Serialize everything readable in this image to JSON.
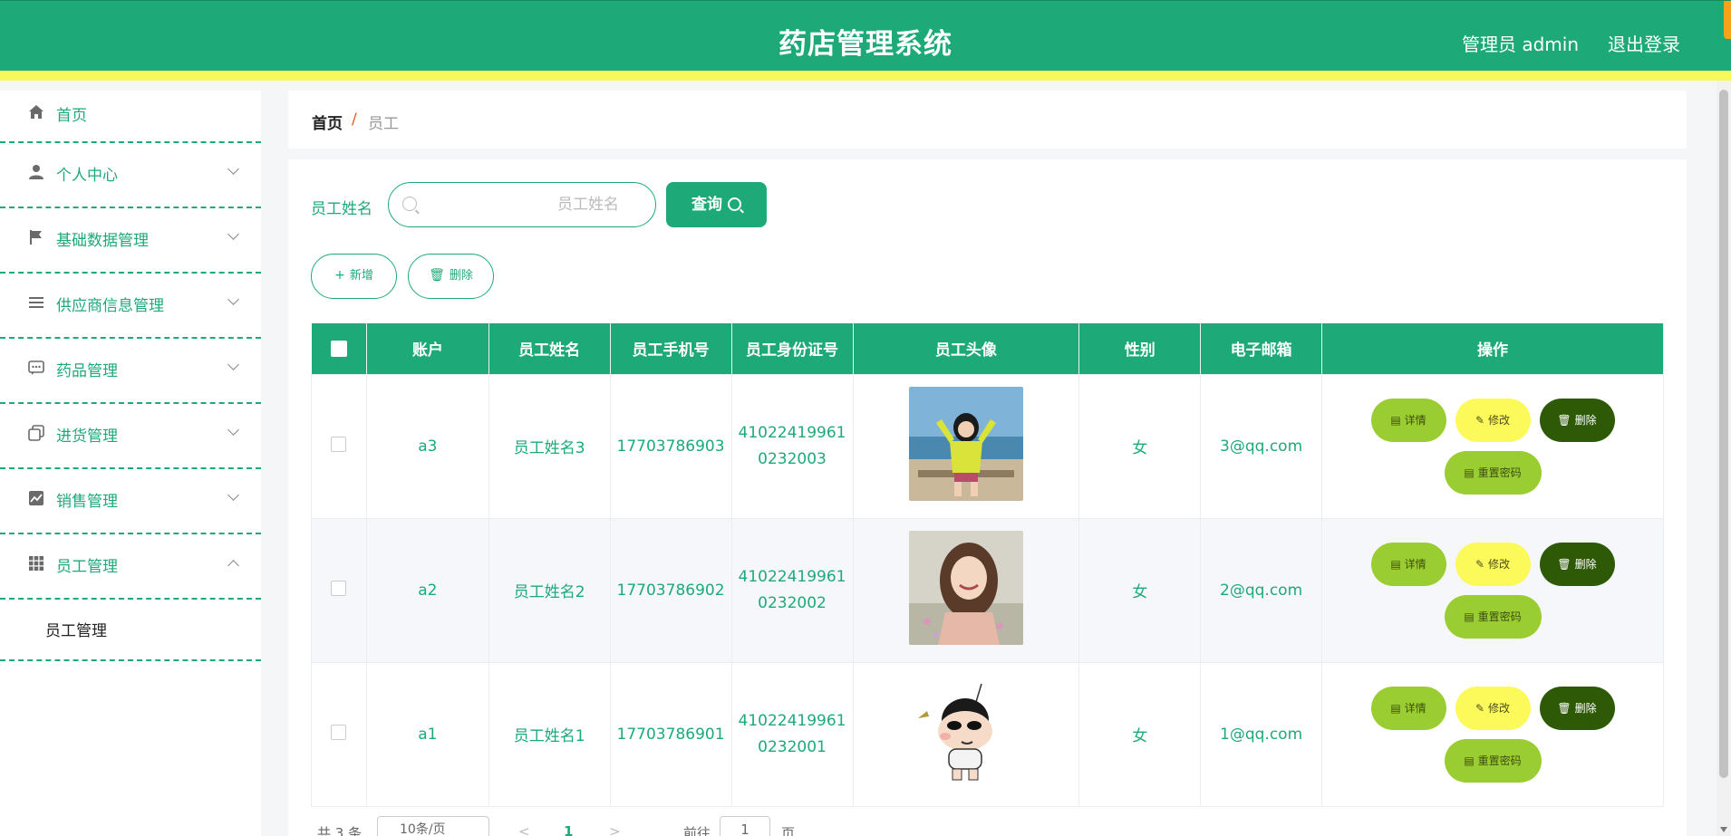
{
  "header": {
    "title": "药店管理系统",
    "user": "管理员 admin",
    "logout": "退出登录"
  },
  "sidebar": {
    "items": [
      {
        "label": "首页",
        "icon": "home-icon"
      },
      {
        "label": "个人中心",
        "icon": "user-icon"
      },
      {
        "label": "基础数据管理",
        "icon": "flag-icon"
      },
      {
        "label": "供应商信息管理",
        "icon": "list-icon"
      },
      {
        "label": "药品管理",
        "icon": "message-icon"
      },
      {
        "label": "进货管理",
        "icon": "copy-icon"
      },
      {
        "label": "销售管理",
        "icon": "chart-icon"
      },
      {
        "label": "员工管理",
        "icon": "grid-icon"
      }
    ],
    "submenu": {
      "label": "员工管理"
    }
  },
  "breadcrumb": {
    "home": "首页",
    "separator": "/",
    "current": "员工"
  },
  "search": {
    "label": "员工姓名",
    "placeholder": "员工姓名",
    "button": "查询"
  },
  "actions": {
    "add": "新增",
    "delete": "删除"
  },
  "table": {
    "headers": [
      "账户",
      "员工姓名",
      "员工手机号",
      "员工身份证号",
      "员工头像",
      "性别",
      "电子邮箱",
      "操作"
    ],
    "rows": [
      {
        "account": "a3",
        "name": "员工姓名3",
        "phone": "17703786903",
        "id1": "41022419961",
        "id2": "0232003",
        "gender": "女",
        "email": "3@qq.com"
      },
      {
        "account": "a2",
        "name": "员工姓名2",
        "phone": "17703786902",
        "id1": "41022419961",
        "id2": "0232002",
        "gender": "女",
        "email": "2@qq.com"
      },
      {
        "account": "a1",
        "name": "员工姓名1",
        "phone": "17703786901",
        "id1": "41022419961",
        "id2": "0232001",
        "gender": "女",
        "email": "1@qq.com"
      }
    ],
    "row_actions": {
      "detail": "详情",
      "edit": "修改",
      "delete": "删除",
      "reset": "重置密码"
    }
  },
  "pagination": {
    "total": "共 3 条",
    "page_size": "10条/页",
    "prev": "<",
    "current": "1",
    "next": ">",
    "goto": "前往",
    "goto_value": "1",
    "unit": "页"
  },
  "colors": {
    "primary": "#1eaa78",
    "accent_yellow": "#f6f85c",
    "detail_green": "#9acd32",
    "edit_yellow": "#fbfa5a",
    "delete_dark": "#2e5a07"
  }
}
